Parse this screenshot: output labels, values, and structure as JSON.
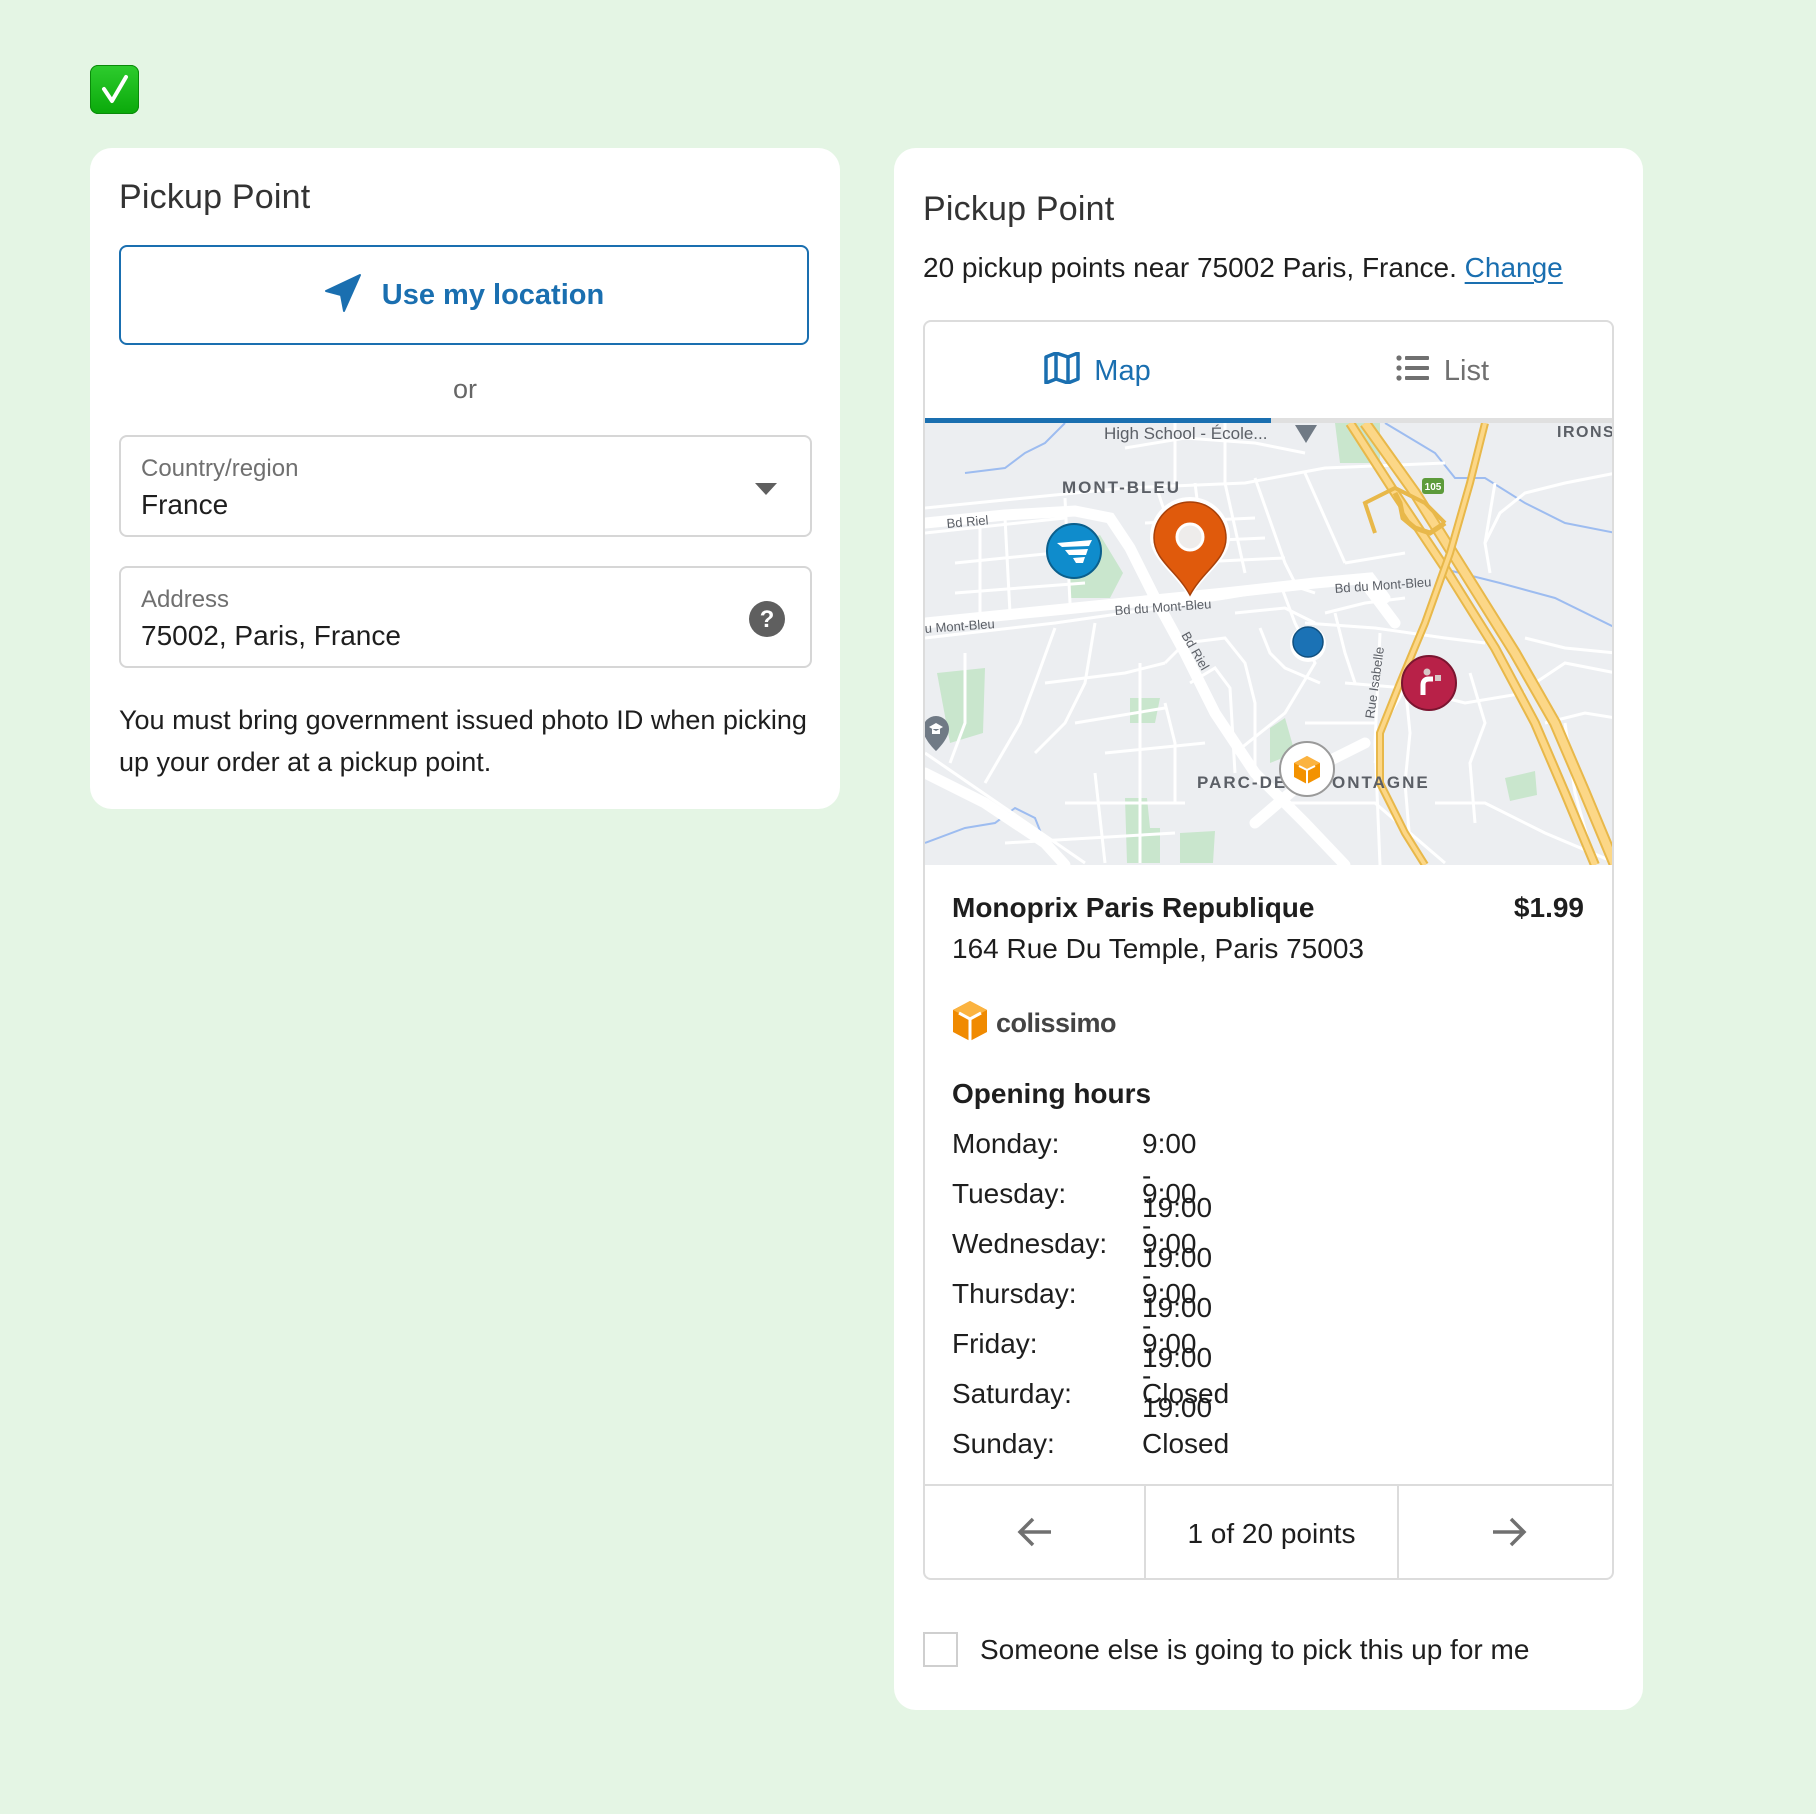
{
  "status_icon": "check-mark-button-icon",
  "left_card": {
    "title": "Pickup Point",
    "use_location_label": "Use my location",
    "or_label": "or",
    "country_field": {
      "label": "Country/region",
      "value": "France"
    },
    "address_field": {
      "label": "Address",
      "value": "75002, Paris, France"
    },
    "note": "You must bring government issued photo ID when picking up your order at a pickup point."
  },
  "right_card": {
    "title": "Pickup Point",
    "summary_text": "20 pickup points near 75002 Paris, France.",
    "change_link": "Change",
    "tabs": [
      {
        "label": "Map",
        "icon": "map-icon",
        "active": true
      },
      {
        "label": "List",
        "icon": "list-icon",
        "active": false
      }
    ],
    "map": {
      "labels": {
        "high_school": "High School -  École...",
        "mont_bleu": "MONT-BLEU",
        "irons": "IRONS",
        "bd_riel_1": "Bd Riel",
        "bd_riel_2": "Bd Riel",
        "bd_mont_bleu_1": "Bd du Mont-Bleu",
        "bd_mont_bleu_2": "Bd du Mont-Bleu",
        "bd_mont_bleu_3": "u Mont-Bleu",
        "rue_isabelle": "Rue Isabelle",
        "parc_left": "PARC-DE-",
        "parc_right": "ONTAGNE",
        "route_105": "105"
      },
      "markers": [
        {
          "name": "carrier-marker-blue",
          "color": "#0f8ccc"
        },
        {
          "name": "selected-location-pin",
          "color": "#e05a0c"
        },
        {
          "name": "current-location-dot",
          "color": "#1b72b5"
        },
        {
          "name": "carrier-marker-relais",
          "color": "#b82148"
        },
        {
          "name": "carrier-marker-colissimo",
          "color": "#f08a00"
        }
      ]
    },
    "selected_point": {
      "name": "Monoprix Paris Republique",
      "price": "$1.99",
      "address": "164 Rue Du Temple, Paris 75003",
      "carrier": "colissimo",
      "hours_title": "Opening hours",
      "hours": [
        {
          "day": "Monday:",
          "time": "9:00 - 19:00"
        },
        {
          "day": "Tuesday:",
          "time": "9:00 - 19:00"
        },
        {
          "day": "Wednesday:",
          "time": "9:00 - 19:00"
        },
        {
          "day": "Thursday:",
          "time": "9:00 - 19:00"
        },
        {
          "day": "Friday:",
          "time": "9:00 - 19:00"
        },
        {
          "day": "Saturday:",
          "time": "Closed"
        },
        {
          "day": "Sunday:",
          "time": "Closed"
        }
      ]
    },
    "pagination": {
      "label": "1 of 20 points",
      "current": 1,
      "total": 20
    },
    "someone_else_checkbox": {
      "label": "Someone else is going to pick this up for me",
      "checked": false
    }
  },
  "colors": {
    "accent": "#1a6fb0",
    "background": "#e4f5e4",
    "border": "#d6d6d6"
  }
}
